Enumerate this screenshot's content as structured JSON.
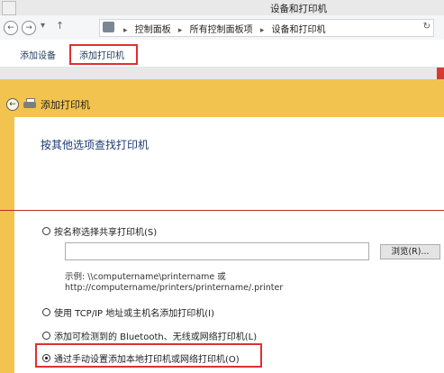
{
  "window": {
    "title": "设备和打印机"
  },
  "address": {
    "crumbs": [
      "控制面板",
      "所有控制面板项",
      "设备和打印机"
    ]
  },
  "toolbar": {
    "add_device": "添加设备",
    "add_printer": "添加打印机"
  },
  "wizard": {
    "title": "添加打印机",
    "heading": "按其他选项查找打印机",
    "options": [
      {
        "label": "按名称选择共享打印机(S)",
        "checked": false
      },
      {
        "label": "使用 TCP/IP 地址或主机名添加打印机(I)",
        "checked": false
      },
      {
        "label": "添加可检测到的 Bluetooth、无线或网络打印机(L)",
        "checked": false
      },
      {
        "label": "通过手动设置添加本地打印机或网络打印机(O)",
        "checked": true
      }
    ],
    "shared_name_value": "",
    "browse_label": "浏览(R)...",
    "example_line1": "示例: \\\\computername\\printername 或",
    "example_line2": "http://computername/printers/printername/.printer"
  },
  "colors": {
    "wizard_background": "#f3c34f",
    "highlight_box": "#e0302f",
    "heading": "#1a3a73"
  }
}
